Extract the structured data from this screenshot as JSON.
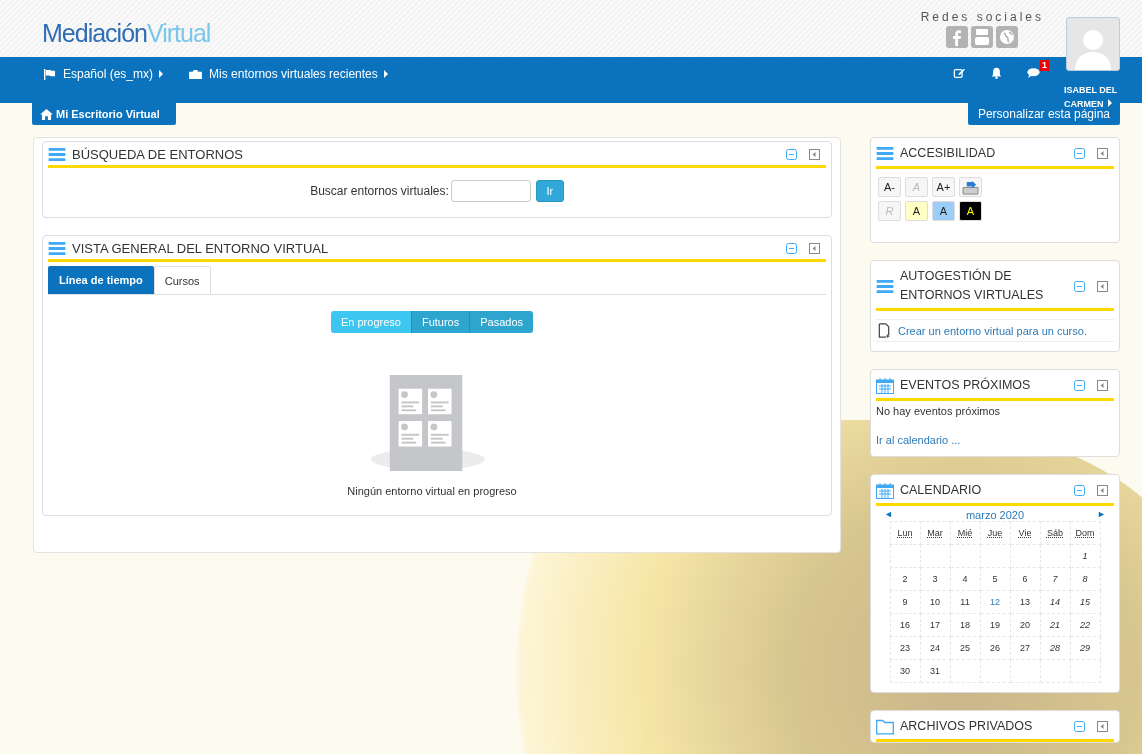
{
  "header": {
    "logo": {
      "part1": "Mediación",
      "part2": "Virtual"
    },
    "social_title": "Redes sociales",
    "user_name": "ISABEL DEL CARMEN"
  },
  "nav": {
    "items": [
      {
        "label": "Español (es_mx)"
      },
      {
        "label": "Mis entornos virtuales recientes"
      }
    ],
    "message_badge": "1"
  },
  "home_button": "Mi Escritorio Virtual",
  "customize_button": "Personalizar esta página",
  "search_block": {
    "title": "BÚSQUEDA DE ENTORNOS",
    "label": "Buscar entornos virtuales:",
    "button": "Ir"
  },
  "overview_block": {
    "title": "VISTA GENERAL DEL ENTORNO VIRTUAL",
    "tabs": [
      {
        "label": "Línea de tiempo",
        "selected": true
      },
      {
        "label": "Cursos",
        "selected": false
      }
    ],
    "filters": [
      {
        "label": "En progreso",
        "selected": true
      },
      {
        "label": "Futuros",
        "selected": false
      },
      {
        "label": "Pasados",
        "selected": false
      }
    ],
    "empty_message": "Ningún entorno virtual en progreso"
  },
  "accessibility": {
    "title": "ACCESIBILIDAD",
    "rows": [
      [
        {
          "label": "A-",
          "kind": "plain",
          "disabled": false
        },
        {
          "label": "A",
          "kind": "plain",
          "disabled": true
        },
        {
          "label": "A+",
          "kind": "plain",
          "disabled": false
        },
        {
          "kind": "save-icon"
        }
      ],
      [
        {
          "label": "R",
          "kind": "plain",
          "disabled": true
        },
        {
          "label": "A",
          "kind": "yellow",
          "disabled": false
        },
        {
          "label": "A",
          "kind": "blue",
          "disabled": false
        },
        {
          "label": "A",
          "kind": "black",
          "disabled": false
        }
      ]
    ]
  },
  "self_service": {
    "title": "AUTOGESTIÓN DE ENTORNOS VIRTUALES",
    "link": "Crear un entorno virtual para un curso."
  },
  "events": {
    "title": "EVENTOS PRÓXIMOS",
    "message": "No hay eventos próximos",
    "link": "Ir al calendario ..."
  },
  "calendar": {
    "title": "CALENDARIO",
    "prev": "◄",
    "next": "►",
    "month": "marzo 2020",
    "weekdays": [
      "Lun",
      "Mar",
      "Mié",
      "Jue",
      "Vie",
      "Sáb",
      "Dom"
    ],
    "weeks": [
      [
        {
          "kind": "empty"
        },
        {
          "kind": "empty"
        },
        {
          "kind": "empty"
        },
        {
          "kind": "empty"
        },
        {
          "kind": "empty"
        },
        {
          "kind": "empty"
        },
        {
          "day": "1",
          "kind": "weekend"
        }
      ],
      [
        {
          "day": "2",
          "kind": "weekday"
        },
        {
          "day": "3",
          "kind": "weekday"
        },
        {
          "day": "4",
          "kind": "weekday"
        },
        {
          "day": "5",
          "kind": "weekday"
        },
        {
          "day": "6",
          "kind": "weekday"
        },
        {
          "day": "7",
          "kind": "weekend"
        },
        {
          "day": "8",
          "kind": "weekend"
        }
      ],
      [
        {
          "day": "9",
          "kind": "weekday"
        },
        {
          "day": "10",
          "kind": "weekday"
        },
        {
          "day": "11",
          "kind": "weekday"
        },
        {
          "day": "12",
          "kind": "today"
        },
        {
          "day": "13",
          "kind": "weekday"
        },
        {
          "day": "14",
          "kind": "weekend"
        },
        {
          "day": "15",
          "kind": "weekend"
        }
      ],
      [
        {
          "day": "16",
          "kind": "weekday"
        },
        {
          "day": "17",
          "kind": "weekday"
        },
        {
          "day": "18",
          "kind": "weekday"
        },
        {
          "day": "19",
          "kind": "weekday"
        },
        {
          "day": "20",
          "kind": "weekday"
        },
        {
          "day": "21",
          "kind": "weekend"
        },
        {
          "day": "22",
          "kind": "weekend"
        }
      ],
      [
        {
          "day": "23",
          "kind": "weekday"
        },
        {
          "day": "24",
          "kind": "weekday"
        },
        {
          "day": "25",
          "kind": "weekday"
        },
        {
          "day": "26",
          "kind": "weekday"
        },
        {
          "day": "27",
          "kind": "weekday"
        },
        {
          "day": "28",
          "kind": "weekend"
        },
        {
          "day": "29",
          "kind": "weekend"
        }
      ],
      [
        {
          "day": "30",
          "kind": "weekday"
        },
        {
          "day": "31",
          "kind": "weekday"
        },
        {
          "kind": "empty"
        },
        {
          "kind": "empty"
        },
        {
          "kind": "empty"
        },
        {
          "kind": "empty"
        },
        {
          "kind": "empty"
        }
      ]
    ]
  },
  "private_files": {
    "title": "ARCHIVOS PRIVADOS"
  }
}
